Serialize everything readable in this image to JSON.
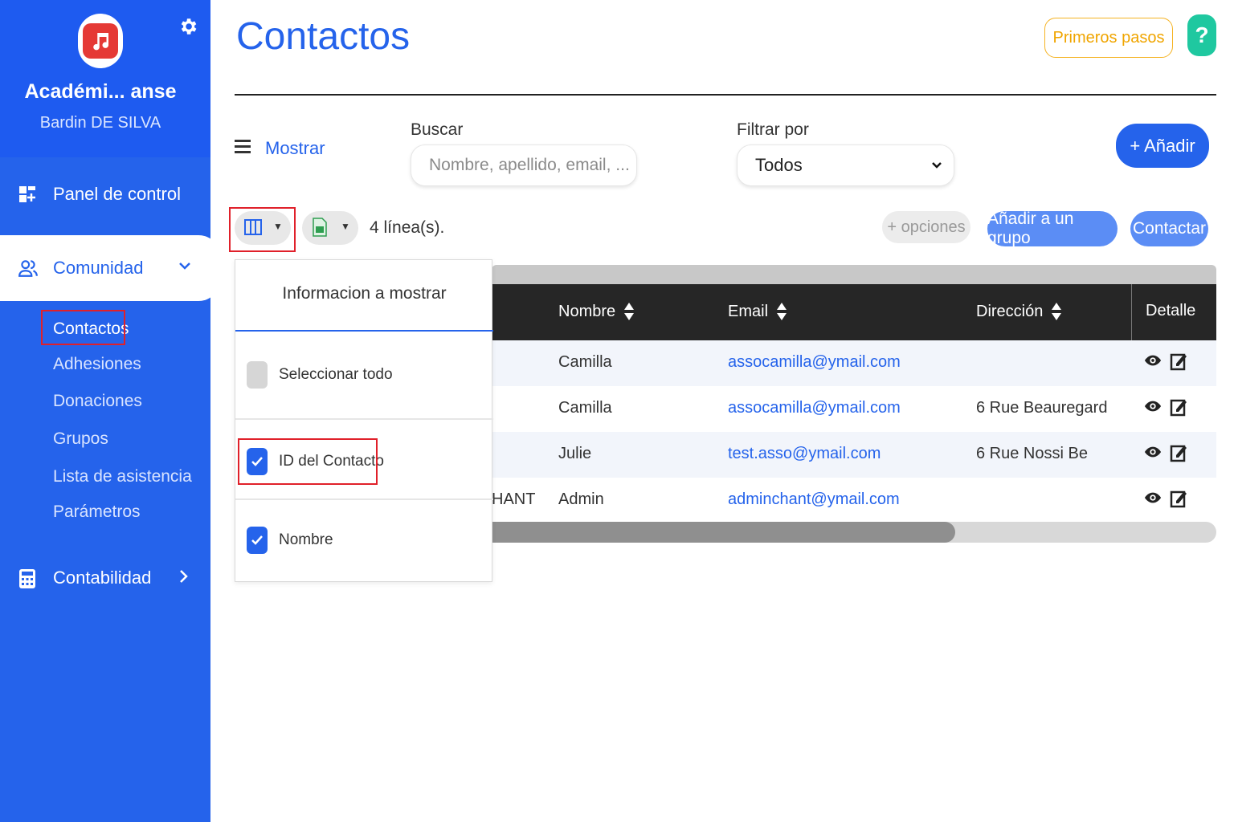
{
  "sidebar": {
    "org_name": "Académi... anse",
    "user_name": "Bardin DE SILVA",
    "nav": {
      "dashboard": "Panel de control",
      "community": "Comunidad",
      "accounting": "Contabilidad"
    },
    "sub_items": [
      "Contactos",
      "Adhesiones",
      "Donaciones",
      "Grupos",
      "Lista de asistencia",
      "Parámetros"
    ]
  },
  "header": {
    "title": "Contactos",
    "first_steps": "Primeros pasos",
    "help": "?"
  },
  "toolbar": {
    "mostrar": "Mostrar",
    "search_label": "Buscar",
    "search_placeholder": "Nombre, apellido, email, ...",
    "filter_label": "Filtrar por",
    "filter_value": "Todos",
    "add_button": "+ Añadir",
    "lines_count": "4 línea(s).",
    "options": "+ opciones",
    "add_to_group": "Añadir a un grupo",
    "contact": "Contactar"
  },
  "table": {
    "columns": [
      "Nombre",
      "Email",
      "Dirección",
      "Detalle"
    ],
    "rows": [
      {
        "id_fragment": "",
        "nombre": "Camilla",
        "email": "assocamilla@ymail.com",
        "direccion": ""
      },
      {
        "id_fragment": "",
        "nombre": "Camilla",
        "email": "assocamilla@ymail.com",
        "direccion": "6 Rue Beauregard"
      },
      {
        "id_fragment": "",
        "nombre": "Julie",
        "email": "test.asso@ymail.com",
        "direccion": "6 Rue Nossi Be"
      },
      {
        "id_fragment": "HANT",
        "nombre": "Admin",
        "email": "adminchant@ymail.com",
        "direccion": ""
      }
    ],
    "scroll_position": 0.64
  },
  "column_popover": {
    "title": "Informacion a mostrar",
    "items": [
      {
        "label": "Seleccionar todo",
        "checked": false
      },
      {
        "label": "ID del Contacto",
        "checked": true
      },
      {
        "label": "Nombre",
        "checked": true
      }
    ]
  },
  "colors": {
    "primary": "#2563eb",
    "sidebar": "#2563eb",
    "accent_orange": "#f0a500",
    "help_green": "#1fc8a0",
    "highlight_red": "#e0202a"
  }
}
